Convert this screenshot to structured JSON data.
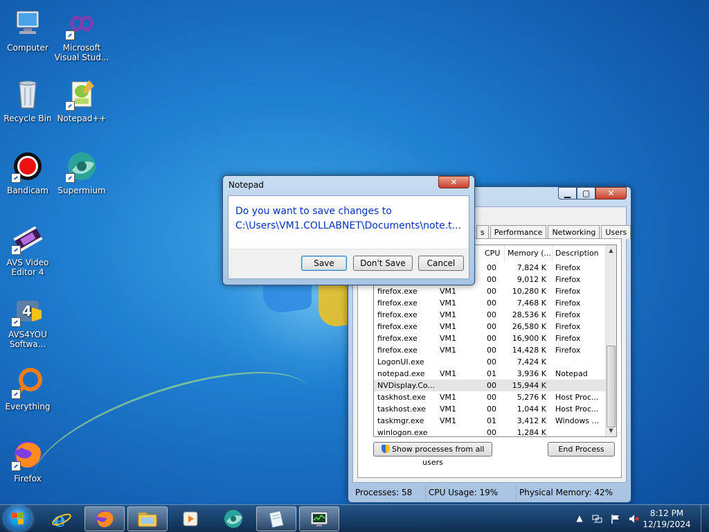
{
  "desktop": {
    "icons": [
      {
        "label": "Computer",
        "icon": "computer-icon"
      },
      {
        "label": "Microsoft\nVisual Stud...",
        "icon": "visual-studio-icon"
      },
      {
        "label": "Recycle Bin",
        "icon": "recycle-bin-icon"
      },
      {
        "label": "Notepad++",
        "icon": "notepad-plus-plus-icon"
      },
      {
        "label": "Bandicam",
        "icon": "bandicam-icon"
      },
      {
        "label": "Supermium",
        "icon": "supermium-icon"
      },
      {
        "label": "AVS Video\nEditor 4",
        "icon": "avs-video-editor-icon"
      },
      {
        "label": "AVS4YOU\nSoftwa...",
        "icon": "avs4you-icon"
      },
      {
        "label": "Everything",
        "icon": "everything-icon"
      },
      {
        "label": "Firefox",
        "icon": "firefox-icon"
      }
    ]
  },
  "task_manager": {
    "tabs": [
      "s",
      "Performance",
      "Networking",
      "Users"
    ],
    "columns": [
      "CPU",
      "Memory (...",
      "Description"
    ],
    "rows": [
      {
        "name": "",
        "user": "",
        "cpu": "00",
        "mem": "7,824 K",
        "desc": "Firefox"
      },
      {
        "name": "firefox.exe",
        "user": "VM1",
        "cpu": "00",
        "mem": "9,012 K",
        "desc": "Firefox"
      },
      {
        "name": "firefox.exe",
        "user": "VM1",
        "cpu": "00",
        "mem": "10,280 K",
        "desc": "Firefox"
      },
      {
        "name": "firefox.exe",
        "user": "VM1",
        "cpu": "00",
        "mem": "7,468 K",
        "desc": "Firefox"
      },
      {
        "name": "firefox.exe",
        "user": "VM1",
        "cpu": "00",
        "mem": "28,536 K",
        "desc": "Firefox"
      },
      {
        "name": "firefox.exe",
        "user": "VM1",
        "cpu": "00",
        "mem": "26,580 K",
        "desc": "Firefox"
      },
      {
        "name": "firefox.exe",
        "user": "VM1",
        "cpu": "00",
        "mem": "16,900 K",
        "desc": "Firefox"
      },
      {
        "name": "firefox.exe",
        "user": "VM1",
        "cpu": "00",
        "mem": "14,428 K",
        "desc": "Firefox"
      },
      {
        "name": "LogonUI.exe",
        "user": "",
        "cpu": "00",
        "mem": "7,424 K",
        "desc": ""
      },
      {
        "name": "notepad.exe",
        "user": "VM1",
        "cpu": "01",
        "mem": "3,936 K",
        "desc": "Notepad"
      },
      {
        "name": "NVDisplay.Co...",
        "user": "",
        "cpu": "00",
        "mem": "15,944 K",
        "desc": ""
      },
      {
        "name": "taskhost.exe",
        "user": "VM1",
        "cpu": "00",
        "mem": "5,276 K",
        "desc": "Host Proc..."
      },
      {
        "name": "taskhost.exe",
        "user": "VM1",
        "cpu": "00",
        "mem": "1,044 K",
        "desc": "Host Proc..."
      },
      {
        "name": "taskmgr.exe",
        "user": "VM1",
        "cpu": "01",
        "mem": "3,412 K",
        "desc": "Windows ..."
      },
      {
        "name": "winlogon.exe",
        "user": "",
        "cpu": "00",
        "mem": "1,284 K",
        "desc": ""
      }
    ],
    "show_all_label": "Show processes from all users",
    "end_process_label": "End Process",
    "status": {
      "processes": "Processes: 58",
      "cpu": "CPU Usage: 19%",
      "memory": "Physical Memory: 42%"
    }
  },
  "notepad_dialog": {
    "title": "Notepad",
    "line1": "Do you want to save changes to",
    "line2": "C:\\Users\\VM1.COLLABNET\\Documents\\note.t...",
    "save_label": "Save",
    "dont_save_label": "Don't Save",
    "cancel_label": "Cancel"
  },
  "taskbar": {
    "time": "8:12 PM",
    "date": "12/19/2024"
  }
}
